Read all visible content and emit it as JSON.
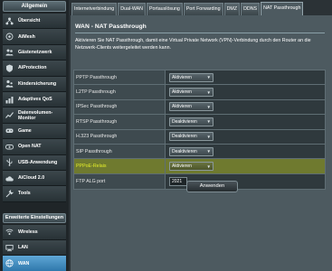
{
  "sidebar": {
    "header": "Allgemein",
    "items": [
      {
        "label": "Übersicht",
        "icon": "network-map-icon"
      },
      {
        "label": "AiMesh",
        "icon": "aimesh-icon"
      },
      {
        "label": "Gästenetzwerk",
        "icon": "guest-network-icon"
      },
      {
        "label": "AiProtection",
        "icon": "shield-icon"
      },
      {
        "label": "Kindersicherung",
        "icon": "parental-control-icon"
      },
      {
        "label": "Adaptives QoS",
        "icon": "qos-icon"
      },
      {
        "label": "Datenvolumen-\nMonitor",
        "icon": "traffic-monitor-icon"
      },
      {
        "label": "Game",
        "icon": "gamepad-icon"
      },
      {
        "label": "Open NAT",
        "icon": "open-nat-icon"
      },
      {
        "label": "USB-Anwendung",
        "icon": "usb-icon"
      },
      {
        "label": "AiCloud 2.0",
        "icon": "cloud-icon"
      },
      {
        "label": "Tools",
        "icon": "tools-icon"
      }
    ],
    "advanced_header": "Erweiterte Einstellungen",
    "advanced_items": [
      {
        "label": "Wireless",
        "icon": "wireless-icon"
      },
      {
        "label": "LAN",
        "icon": "lan-icon"
      },
      {
        "label": "WAN",
        "icon": "globe-icon"
      }
    ]
  },
  "tabs": [
    "Internetverbindung",
    "Dual-WAN",
    "Portauslösung",
    "Port Forwarding",
    "DMZ",
    "DDNS",
    "NAT Passthrough"
  ],
  "active_tab_index": 6,
  "page": {
    "title": "WAN - NAT Passthrough",
    "description": "Aktivieren Sie NAT Passthrough, damit eine Virtual Private Network (VPN)-Verbindung durch den Router an die Netzwerk-Clients weitergeleitet werden kann."
  },
  "settings": [
    {
      "label": "PPTP Passthrough",
      "value": "Aktivieren"
    },
    {
      "label": "L2TP Passthrough",
      "value": "Aktivieren"
    },
    {
      "label": "IPSec Passthrough",
      "value": "Aktivieren"
    },
    {
      "label": "RTSP Passthrough",
      "value": "Deaktivieren"
    },
    {
      "label": "H.323 Passthrough",
      "value": "Deaktivieren"
    },
    {
      "label": "SIP Passthrough",
      "value": "Deaktivieren"
    },
    {
      "label": "PPPoE-Relais",
      "value": "Aktivieren"
    },
    {
      "label": "FTP ALG port",
      "value": "2021"
    }
  ],
  "apply_label": "Anwenden",
  "colors": {
    "highlight_row": "#6f7a2f",
    "highlight_text": "#e4ee2a",
    "active_nav": "#2f78ab"
  }
}
